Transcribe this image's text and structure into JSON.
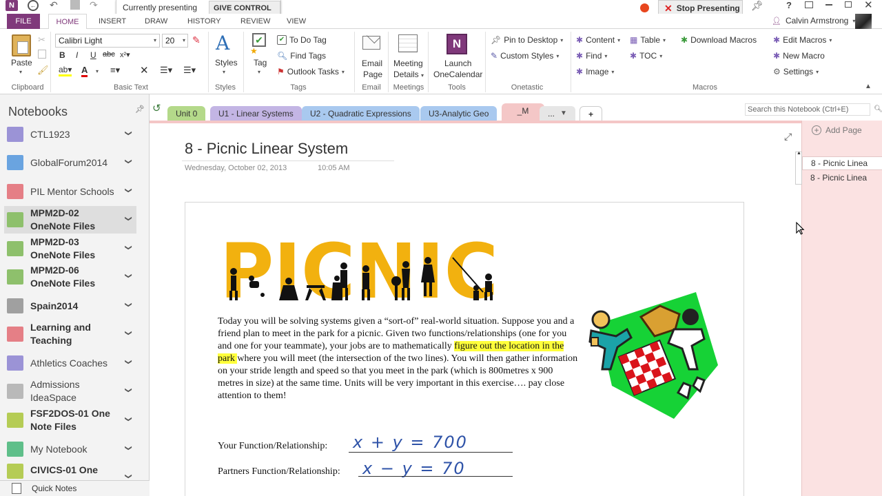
{
  "app": {
    "logo": "N",
    "presenting": "Currently presenting",
    "give_control": "GIVE CONTROL",
    "stop_presenting": "Stop Presenting",
    "user": "Calvin Armstrong",
    "help": "?"
  },
  "ribbon_tabs": [
    "FILE",
    "HOME",
    "INSERT",
    "DRAW",
    "HISTORY",
    "REVIEW",
    "VIEW"
  ],
  "ribbon": {
    "paste": "Paste",
    "font_name": "Calibri Light",
    "font_size": "20",
    "styles": "Styles",
    "tag": "Tag",
    "todo_tag": "To Do Tag",
    "find_tags": "Find Tags",
    "outlook_tasks": "Outlook Tasks",
    "email_page_1": "Email",
    "email_page_2": "Page",
    "meeting_1": "Meeting",
    "meeting_2": "Details",
    "launch_1": "Launch",
    "launch_2": "OneCalendar",
    "pin_desktop": "Pin to Desktop",
    "custom_styles": "Custom Styles",
    "content": "Content",
    "find": "Find",
    "image": "Image",
    "table": "Table",
    "toc": "TOC",
    "download_macros": "Download Macros",
    "edit_macros": "Edit Macros",
    "new_macro": "New Macro",
    "settings": "Settings",
    "groups": [
      "Clipboard",
      "Basic Text",
      "Styles",
      "Tags",
      "Email",
      "Meetings",
      "Tools",
      "Onetastic",
      "Macros"
    ]
  },
  "notebooks": {
    "title": "Notebooks",
    "items": [
      {
        "l1": "CTL1923",
        "l2": "",
        "color": "#9b93d6",
        "bold": false
      },
      {
        "l1": "GlobalForum2014",
        "l2": "",
        "color": "#6aa4e0",
        "bold": false
      },
      {
        "l1": "PIL Mentor Schools",
        "l2": "",
        "color": "#e57f86",
        "bold": false
      },
      {
        "l1": "MPM2D-02",
        "l2": "OneNote Files",
        "color": "#8ec06c",
        "bold": true
      },
      {
        "l1": "MPM2D-03",
        "l2": "OneNote Files",
        "color": "#8ec06c",
        "bold": true
      },
      {
        "l1": "MPM2D-06",
        "l2": "OneNote Files",
        "color": "#8ec06c",
        "bold": true
      },
      {
        "l1": "Spain2014",
        "l2": "",
        "color": "#a0a0a0",
        "bold": true
      },
      {
        "l1": "Learning and",
        "l2": "Teaching",
        "color": "#e57f86",
        "bold": true
      },
      {
        "l1": "Athletics Coaches",
        "l2": "",
        "color": "#9b93d6",
        "bold": false
      },
      {
        "l1": "Admissions",
        "l2": "IdeaSpace",
        "color": "#b9b9b9",
        "bold": false
      },
      {
        "l1": "FSF2DOS-01 One",
        "l2": "Note Files",
        "color": "#b5cc55",
        "bold": true
      },
      {
        "l1": "My Notebook",
        "l2": "",
        "color": "#5fbf8a",
        "bold": false
      },
      {
        "l1": "CIVICS-01 One",
        "l2": "",
        "color": "#b5cc55",
        "bold": true
      }
    ],
    "quick_notes": "Quick Notes"
  },
  "section_tabs": [
    {
      "label": "Unit 0",
      "color": "#b4d98a"
    },
    {
      "label": "U1 - Linear Systems",
      "color": "#c3b5e4"
    },
    {
      "label": "U2 - Quadratic Expressions",
      "color": "#a9c9ef"
    },
    {
      "label": "U3-Analytic Geo",
      "color": "#a9c9ef"
    },
    {
      "label": "_M",
      "color": "#f4c7c7"
    },
    {
      "label": "...",
      "color": "#e6e6e6"
    },
    {
      "label": "+",
      "color": "#ffffff"
    }
  ],
  "search": {
    "placeholder": "Search this Notebook (Ctrl+E)"
  },
  "page": {
    "title": "8 - Picnic Linear System",
    "date": "Wednesday, October 02, 2013",
    "time": "10:05 AM",
    "picnic_word": "PICNIC",
    "body_pre": "Today you will be solving systems given a “sort-of” real-world situation. Suppose you and a friend plan to meet in the park for a picnic. Given two functions/relationships (one for you and one for your teammate), your jobs are to mathematically ",
    "body_highlight": "figure out the location in the park ",
    "body_post": "where you will meet (the intersection of the two lines). You will then gather information on your stride length and speed so that you meet in the park (which is 800metres x 900 metres in size) at the same time. Units will be very important in this exercise…. pay close attention to them!",
    "your_fn_label": "Your Function/Relationship:",
    "your_fn_value": "x + y = 700",
    "partner_fn_label": "Partners Function/Relationship:",
    "partner_fn_value": "x − y = 70"
  },
  "pages_pane": {
    "add_page": "Add Page",
    "pages": [
      "8 - Picnic Linea",
      "8 - Picnic Linea"
    ]
  }
}
